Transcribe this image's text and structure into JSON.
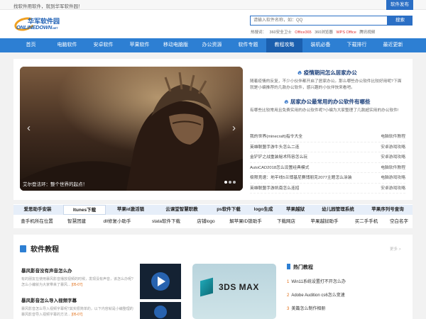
{
  "topbar": {
    "slogan": "找软件用软件，就到华军软件园！",
    "publish": "软件发布"
  },
  "logo": {
    "cn": "华军软件园",
    "en": "ONLINEDOWN",
    "en_suffix": ".NET"
  },
  "search": {
    "placeholder": "请输入软件名称，如：QQ",
    "button": "搜索",
    "hot_label": "热搜词：",
    "hot_words": [
      {
        "text": "360安全卫士",
        "red": false
      },
      {
        "text": "Office365",
        "red": true
      },
      {
        "text": "360浏览器",
        "red": false
      },
      {
        "text": "WPS Office",
        "red": true
      },
      {
        "text": "腾讯视频",
        "red": false
      }
    ]
  },
  "nav": {
    "items": [
      {
        "label": "首页",
        "active": false
      },
      {
        "label": "电脑软件",
        "active": false
      },
      {
        "label": "安卓软件",
        "active": false
      },
      {
        "label": "苹果软件",
        "active": false
      },
      {
        "label": "移动电脑版",
        "active": false
      },
      {
        "label": "办公资源",
        "active": false
      },
      {
        "label": "软件专题",
        "active": false
      },
      {
        "label": "教程攻略",
        "active": true
      },
      {
        "label": "装机必备",
        "active": false
      },
      {
        "label": "下载排行",
        "active": false
      },
      {
        "label": "最近更新",
        "active": false
      }
    ]
  },
  "slider": {
    "caption": "艾尔登法环：整个世界的起点！",
    "prev": "‹",
    "next": "›",
    "slides": 3,
    "current": 1
  },
  "featured": [
    {
      "title": "疫情期间怎么居家办公",
      "desc": "随着疫情的反复，不少小伙伴都开启了居家办公。那么哪些办公软件比较好用呢?下面就是小编推荐的几款办公软件，感兴趣的小伙伴快来看吧。"
    },
    {
      "title": "居家办公最常用的办公软件有哪些",
      "desc": "有哪些比较常用且免费实用的办公软件呢?小编为大家整理了几款超实用的办公软件!"
    }
  ],
  "newslist": [
    {
      "title": "我的世界(minecraft)指令大全",
      "cat": "电脑软件教程"
    },
    {
      "title": "英雄联盟手游牛头怎么二连",
      "cat": "安卓游戏攻略"
    },
    {
      "title": "金铲铲之战重装秘术阵容怎么玩",
      "cat": "安卓游戏攻略"
    },
    {
      "title": "AutoCAD2018怎么设置经典模式",
      "cat": "电脑软件教程"
    },
    {
      "title": "极限竞速：地平线5兰博基尼赛博朋克2077主题怎么涂装",
      "cat": "电脑游戏攻略"
    },
    {
      "title": "英雄联盟手游凯南怎么连招",
      "cat": "安卓游戏攻略"
    }
  ],
  "tags_row1": [
    "爱思助手安装",
    "Itunes下载",
    "苹果id激活锁",
    "云课堂智慧职教",
    "ps软件下载",
    "logo生成",
    "苹果越狱",
    "幼儿园管理系统",
    "苹果序列号查询"
  ],
  "tags_row2": [
    "查手机所在位置",
    "智慧团建",
    "dll修复小助手",
    "stata软件下载",
    "店铺logo",
    "解苹果ID锁助手",
    "下载网店",
    "苹果越狱助手",
    "买二手手机",
    "空白名字"
  ],
  "tutorial": {
    "title": "软件教程",
    "more": "更多 >",
    "articles": [
      {
        "title": "暴风影音没有声音怎么办",
        "desc": "有的朋友在使用暴风影音播放视频的时候，发现没有声音，该怎么办呢?怎么小编就为大家带来了暴风...",
        "date": "[05-07]"
      },
      {
        "title": "暴风影音怎么导入视频字幕",
        "desc": "暴风影音怎么导入视频字幕呢?其实很简单的，以下内容就是小编整理的暴风影音导入视频字幕的方法...",
        "date": "[05-07]"
      }
    ],
    "big_thumb_label": "3DS MAX",
    "hot_title": "热门教程",
    "hot_list": [
      "Win11系统设置打不开怎么办",
      "Adobe Audition cs6怎么变速",
      "美篇怎么制作相册"
    ]
  }
}
